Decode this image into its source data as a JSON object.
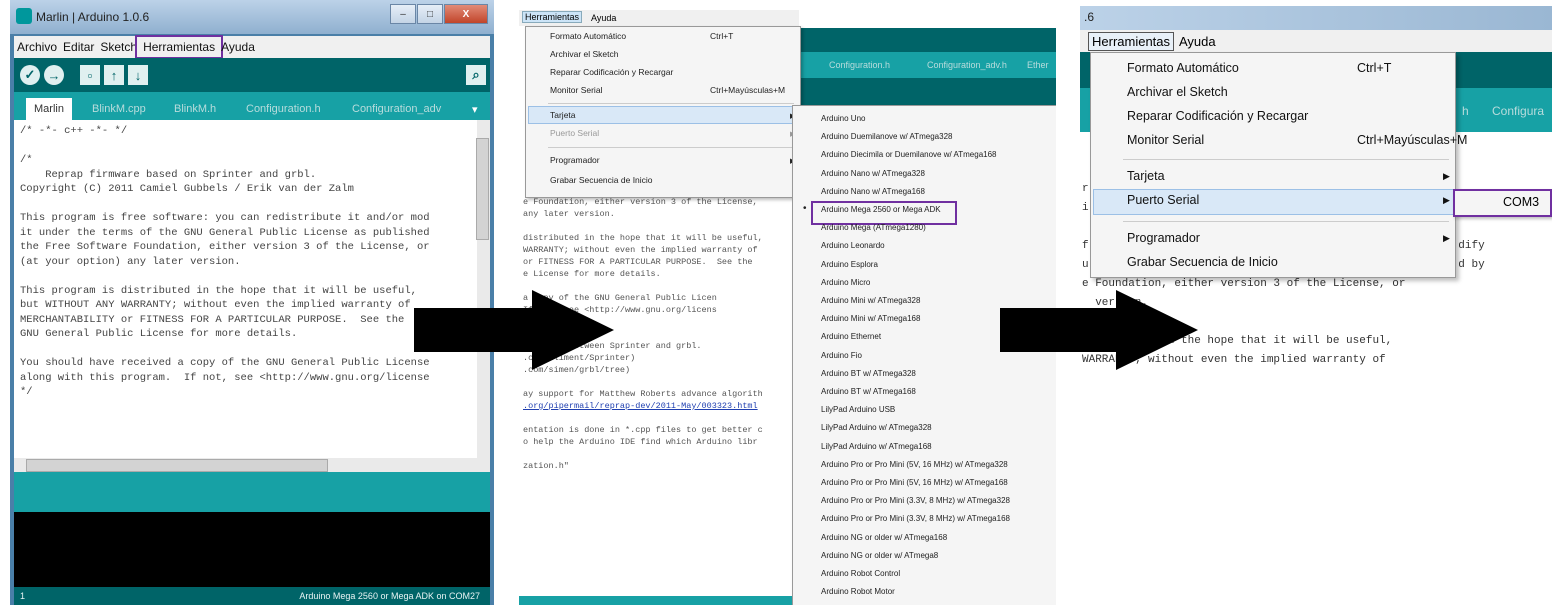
{
  "panel1": {
    "window_title": "Marlin | Arduino 1.0.6",
    "window_buttons": {
      "minimize": "–",
      "maximize": "□",
      "close": "X"
    },
    "menu": [
      "Archivo",
      "Editar",
      "Sketch",
      "Herramientas",
      "Ayuda"
    ],
    "tabs": [
      "Marlin",
      "BlinkM.cpp",
      "BlinkM.h",
      "Configuration.h",
      "Configuration_adv"
    ],
    "code_lines": [
      "/* -*- c++ -*- */",
      "",
      "/*",
      "    Reprap firmware based on Sprinter and grbl.",
      "Copyright (C) 2011 Camiel Gubbels / Erik van der Zalm",
      "",
      "This program is free software: you can redistribute it and/or mod",
      "it under the terms of the GNU General Public License as published",
      "the Free Software Foundation, either version 3 of the License, or",
      "(at your option) any later version.",
      "",
      "This program is distributed in the hope that it will be useful,",
      "but WITHOUT ANY WARRANTY; without even the implied warranty of",
      "MERCHANTABILITY or FITNESS FOR A PARTICULAR PURPOSE.  See the",
      "GNU General Public License for more details.",
      "",
      "You should have received a copy of the GNU General Public License",
      "along with this program.  If not, see <http://www.gnu.org/license",
      "*/"
    ],
    "line_number": "1",
    "board_status": "Arduino Mega 2560 or Mega ADK on COM27"
  },
  "panel2": {
    "menubar": [
      "Herramientas",
      "Ayuda"
    ],
    "bg_tabs": [
      "Configuration.h",
      "Configuration_adv.h",
      "Ether"
    ],
    "menu_items": [
      {
        "label": "Formato Automático",
        "shortcut": "Ctrl+T"
      },
      {
        "label": "Archivar el Sketch",
        "shortcut": ""
      },
      {
        "label": "Reparar Codificación y Recargar",
        "shortcut": ""
      },
      {
        "label": "Monitor Serial",
        "shortcut": "Ctrl+Mayúsculas+M"
      },
      {
        "label": "Tarjeta",
        "shortcut": ""
      },
      {
        "label": "Puerto Serial",
        "shortcut": ""
      },
      {
        "label": "Programador",
        "shortcut": ""
      },
      {
        "label": "Grabar Secuencia de Inicio",
        "shortcut": ""
      }
    ],
    "boards": [
      "Arduino Uno",
      "Arduino Duemilanove w/ ATmega328",
      "Arduino Diecimila or Duemilanove w/ ATmega168",
      "Arduino Nano w/ ATmega328",
      "Arduino Nano w/ ATmega168",
      "Arduino Mega 2560 or Mega ADK",
      "Arduino Mega (ATmega1280)",
      "Arduino Leonardo",
      "Arduino Esplora",
      "Arduino Micro",
      "Arduino Mini w/ ATmega328",
      "Arduino Mini w/ ATmega168",
      "Arduino Ethernet",
      "Arduino Fio",
      "Arduino BT w/ ATmega328",
      "Arduino BT w/ ATmega168",
      "LilyPad Arduino USB",
      "LilyPad Arduino w/ ATmega328",
      "LilyPad Arduino w/ ATmega168",
      "Arduino Pro or Pro Mini (5V, 16 MHz) w/ ATmega328",
      "Arduino Pro or Pro Mini (5V, 16 MHz) w/ ATmega168",
      "Arduino Pro or Pro Mini (3.3V, 8 MHz) w/ ATmega328",
      "Arduino Pro or Pro Mini (3.3V, 8 MHz) w/ ATmega168",
      "Arduino NG or older w/ ATmega168",
      "Arduino NG or older w/ ATmega8",
      "Arduino Robot Control",
      "Arduino Robot Motor"
    ],
    "selected_board_marker": "•",
    "bg_code_lines": [
      "e Foundation, either version 3 of the License,",
      "any later version.",
      "",
      "distributed in the hope that it will be useful,",
      "WARRANTY; without even the implied warranty of",
      "or FITNESS FOR A PARTICULAR PURPOSE.  See the",
      "e License for more details.",
      "",
      "a copy of the GNU General Public Licen",
      "If not, see <http://www.gnu.org/licens",
      "",
      "",
      "a mashup between Sprinter and grbl.",
      ".com/kliment/Sprinter)",
      ".com/simen/grbl/tree)",
      "",
      "ay support for Matthew Roberts advance algorith",
      ".org/pipermail/reprap-dev/2011-May/003323.html",
      "",
      "entation is done in *.cpp files to get better c",
      "o help the Arduino IDE find which Arduino libr",
      "",
      "zation.h\""
    ]
  },
  "panel3": {
    "title_fragment": ".6",
    "menubar": [
      "Herramientas",
      "Ayuda"
    ],
    "bg_tabs": [
      "h",
      "Configura"
    ],
    "menu_items": [
      {
        "label": "Formato Automático",
        "shortcut": "Ctrl+T"
      },
      {
        "label": "Archivar el Sketch",
        "shortcut": ""
      },
      {
        "label": "Reparar Codificación y Recargar",
        "shortcut": ""
      },
      {
        "label": "Monitor Serial",
        "shortcut": "Ctrl+Mayúsculas+M"
      },
      {
        "label": "Tarjeta",
        "shortcut": ""
      },
      {
        "label": "Puerto Serial",
        "shortcut": ""
      },
      {
        "label": "Programador",
        "shortcut": ""
      },
      {
        "label": "Grabar Secuencia de Inicio",
        "shortcut": ""
      }
    ],
    "port": "COM3",
    "bg_code_lines": [
      "r",
      "i",
      "",
      "f                                                        dify",
      "u                                                        d by",
      "e Foundation, either version 3 of the License, or",
      "  version.",
      "",
      "distributed in the hope that it will be useful,",
      "WARRANTY; without even the implied warranty of"
    ]
  },
  "colors": {
    "arduino_dark": "#006468",
    "arduino_teal": "#17a1a5",
    "highlight": "#7030a0",
    "arrow": "#000000"
  }
}
